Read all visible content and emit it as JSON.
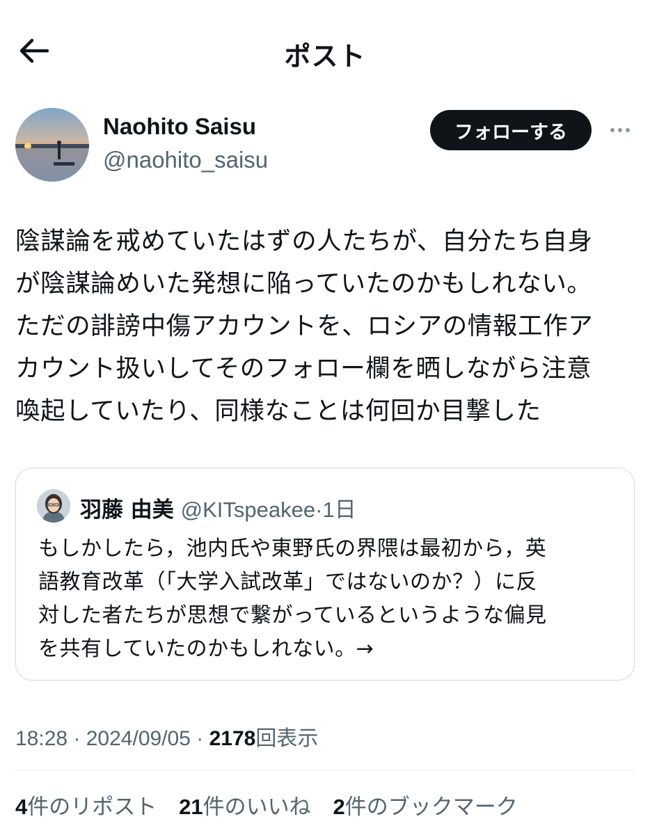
{
  "header": {
    "title": "ポスト",
    "back_icon": "arrow-left-icon"
  },
  "author": {
    "name": "Naohito Saisu",
    "handle": "@naohito_saisu",
    "follow_label": "フォローする",
    "more_icon": "more-horizontal-icon"
  },
  "post": {
    "text": "陰謀論を戒めていたはずの人たちが、自分たち自身\nが陰謀論めいた発想に陥っていたのかもしれない。\nただの誹謗中傷アカウントを、ロシアの情報工作ア\nカウント扱いしてそのフォロー欄を晒しながら注意\n喚起していたり、同様なことは何回か目撃した"
  },
  "quote": {
    "name": "羽藤 由美",
    "handle": "@KITspeakee",
    "separator": "·",
    "time": "1日",
    "text": "もしかしたら，池内氏や東野氏の界隈は最初から，英\n語教育改革（「大学入試改革」ではないのか？）に反\n対した者たちが思想で繋がっているというような偏見\nを共有していたのかもしれない。→"
  },
  "meta": {
    "time": "18:28",
    "sep1": " · ",
    "date": "2024/09/05",
    "sep2": " · ",
    "views": "2178",
    "views_label": "回表示"
  },
  "stats": {
    "reposts_count": "4",
    "reposts_label": "件のリポスト",
    "likes_count": "21",
    "likes_label": "件のいいね",
    "bookmarks_count": "2",
    "bookmarks_label": "件のブックマーク"
  },
  "colors": {
    "text": "#0f1419",
    "secondary": "#536471",
    "border": "#cfd9de",
    "button": "#0f1419"
  }
}
